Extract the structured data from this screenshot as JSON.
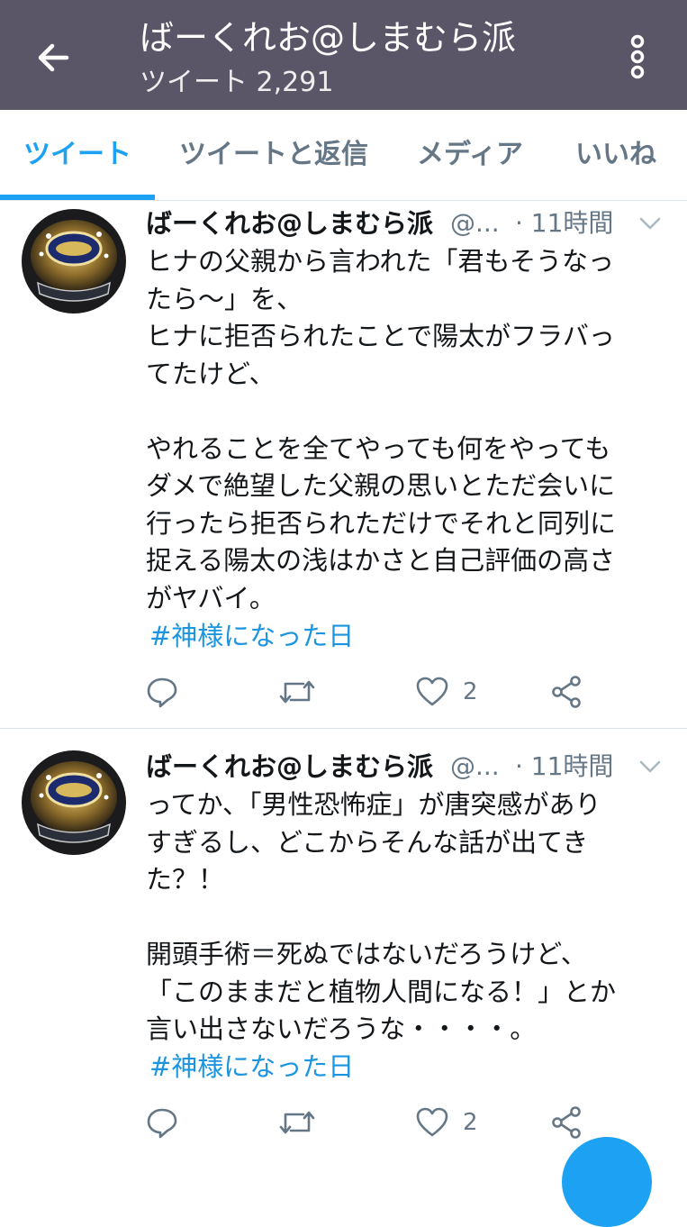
{
  "header": {
    "title": "ばーくれお@しまむら派",
    "subtitle": "ツイート 2,291",
    "bg_color": "#5a5567"
  },
  "tabs": [
    {
      "label": "ツイート",
      "active": true
    },
    {
      "label": "ツイートと返信",
      "active": false
    },
    {
      "label": "メディア",
      "active": false
    },
    {
      "label": "いいね",
      "active": false
    }
  ],
  "accent_color": "#1da1f2",
  "tweets": [
    {
      "name": "ばーくれお@しまむら派",
      "handle": "@...",
      "time": "· 11時間",
      "text": "ヒナの父親から言われた「君もそうなっ\nたら〜」を、\nヒナに拒否られたことで陽太がフラバっ\nてたけど、\n\nやれることを全てやっても何をやっても\nダメで絶望した父親の思いとただ会いに\n行ったら拒否られただけでそれと同列に\n捉える陽太の浅はかさと自己評価の高さ\nがヤバイ。",
      "hashtag": "#神様になった日",
      "likes": "2"
    },
    {
      "name": "ばーくれお@しまむら派",
      "handle": "@...",
      "time": "· 11時間",
      "text": "ってか、「男性恐怖症」が唐突感があり\nすぎるし、どこからそんな話が出てき\nた？！\n\n開頭手術＝死ぬではないだろうけど、\n「このままだと植物人間になる！」とか\n言い出さないだろうな・・・・。",
      "hashtag": "#神様になった日",
      "likes": "2"
    }
  ],
  "icons": {
    "back": "back-arrow-icon",
    "overflow": "more-vertical-icon",
    "reply": "reply-icon",
    "retweet": "retweet-icon",
    "like": "heart-icon",
    "share": "share-icon",
    "caret": "chevron-down-icon",
    "avatar": "championship-ring-avatar"
  }
}
